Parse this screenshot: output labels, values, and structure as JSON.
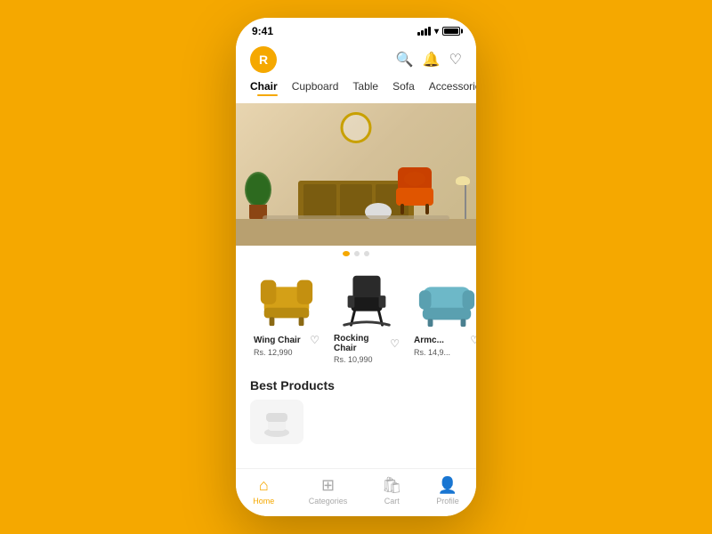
{
  "status_bar": {
    "time": "9:41"
  },
  "header": {
    "logo_letter": "R"
  },
  "categories": [
    {
      "label": "Chair",
      "active": true
    },
    {
      "label": "Cupboard",
      "active": false
    },
    {
      "label": "Table",
      "active": false
    },
    {
      "label": "Sofa",
      "active": false
    },
    {
      "label": "Accessories",
      "active": false
    }
  ],
  "products": [
    {
      "name": "Wing Chair",
      "price": "Rs. 12,990",
      "color": "#D4A017",
      "chair_type": "wing"
    },
    {
      "name": "Rocking Chair",
      "price": "Rs. 10,990",
      "color": "#1a1a1a",
      "chair_type": "rocking"
    },
    {
      "name": "Armc...",
      "price": "Rs. 14,9...",
      "color": "#6db8c8",
      "chair_type": "arm"
    }
  ],
  "best_products": {
    "title": "Best Products"
  },
  "bottom_nav": [
    {
      "label": "Home",
      "icon": "🏠",
      "active": true
    },
    {
      "label": "Categories",
      "icon": "⊞",
      "active": false
    },
    {
      "label": "Cart",
      "icon": "🛍",
      "active": false
    },
    {
      "label": "Profile",
      "icon": "👤",
      "active": false
    }
  ]
}
